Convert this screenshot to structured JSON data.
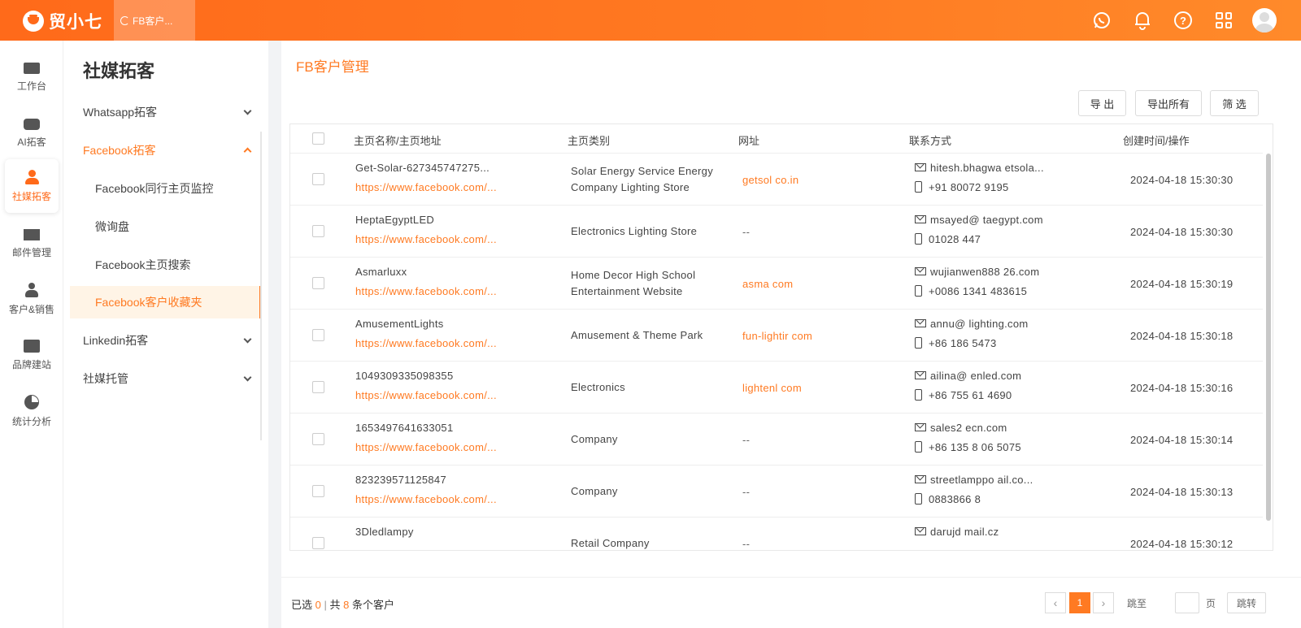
{
  "app": {
    "logo_text": "贸小七"
  },
  "top_tab": {
    "label": "FB客户..."
  },
  "rail": [
    {
      "label": "工作台",
      "icon": "monitor-icon"
    },
    {
      "label": "AI拓客",
      "icon": "robot-icon"
    },
    {
      "label": "社媒拓客",
      "icon": "person-icon",
      "active": true
    },
    {
      "label": "邮件管理",
      "icon": "mail-icon"
    },
    {
      "label": "客户&销售",
      "icon": "user-tie-icon"
    },
    {
      "label": "品牌建站",
      "icon": "chart-icon"
    },
    {
      "label": "统计分析",
      "icon": "pie-chart-icon"
    }
  ],
  "sidebar": {
    "title": "社媒拓客",
    "items": [
      {
        "label": "Whatsapp拓客"
      },
      {
        "label": "Facebook拓客"
      },
      {
        "label": "Facebook同行主页监控"
      },
      {
        "label": "微询盘"
      },
      {
        "label": "Facebook主页搜索"
      },
      {
        "label": "Facebook客户收藏夹"
      },
      {
        "label": "Linkedin拓客"
      },
      {
        "label": "社媒托管"
      }
    ]
  },
  "main": {
    "title": "FB客户管理",
    "buttons": {
      "export": "导 出",
      "export_all": "导出所有",
      "filter": "筛 选"
    }
  },
  "table": {
    "headers": [
      "主页名称/主页地址",
      "主页类别",
      "网址",
      "联系方式",
      "创建时间/操作"
    ],
    "rows": [
      {
        "name": "Get-Solar-627345747275...",
        "url": "https://www.facebook.com/...",
        "category": "Solar Energy Service Energy Company Lighting Store",
        "website": "getsol   co.in",
        "email": "hitesh.bhagwa      etsola...",
        "phone": "+91 80072   9195",
        "time": "2024-04-18 15:30:30"
      },
      {
        "name": "HeptaEgyptLED",
        "url": "https://www.facebook.com/...",
        "category": "Electronics Lighting Store",
        "website": "--",
        "email": "msayed@     taegypt.com",
        "phone": "01028      447",
        "time": "2024-04-18 15:30:30"
      },
      {
        "name": "Asmarluxx",
        "url": "https://www.facebook.com/...",
        "category": "Home Decor High School Entertainment Website",
        "website": "asma      com",
        "email": "wujianwen888      26.com",
        "phone": "+0086 1341  483615",
        "time": "2024-04-18 15:30:19"
      },
      {
        "name": "AmusementLights",
        "url": "https://www.facebook.com/...",
        "category": "Amusement & Theme Park",
        "website": "fun-lightir    com",
        "email": "annu@     lighting.com",
        "phone": "+86 186     5473",
        "time": "2024-04-18 15:30:18"
      },
      {
        "name": "1049309335098355",
        "url": "https://www.facebook.com/...",
        "category": "Electronics",
        "website": "lightenl     com",
        "email": "ailina@     enled.com",
        "phone": "+86 755 61   4690",
        "time": "2024-04-18 15:30:16"
      },
      {
        "name": "1653497641633051",
        "url": "https://www.facebook.com/...",
        "category": "Company",
        "website": "--",
        "email": "sales2     ecn.com",
        "phone": "+86 135 8 06 5075",
        "time": "2024-04-18 15:30:14"
      },
      {
        "name": "823239571125847",
        "url": "https://www.facebook.com/...",
        "category": "Company",
        "website": "--",
        "email": "streetlamppo       ail.co...",
        "phone": "0883866  8",
        "time": "2024-04-18 15:30:13"
      },
      {
        "name": "3Dledlampy",
        "url": "",
        "category": "Retail Company",
        "website": "--",
        "email": "darujd      mail.cz",
        "phone": "",
        "time": "2024-04-18 15:30:12"
      }
    ]
  },
  "footer": {
    "selected_prefix": "已选",
    "selected_count": "0",
    "separator": "|",
    "total_prefix": "共",
    "total_count": "8",
    "total_suffix": "条个客户",
    "current_page": "1",
    "jump_prefix": "跳至",
    "jump_suffix": "页",
    "jump_button": "跳转"
  },
  "colors": {
    "accent": "#ff7a22",
    "topbar": "#ff6a1a"
  }
}
